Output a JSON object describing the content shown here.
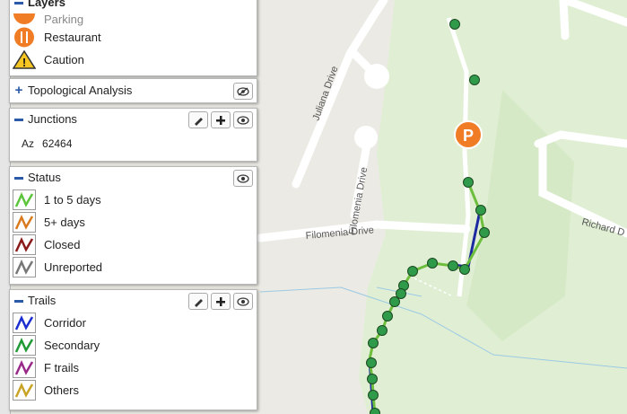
{
  "map": {
    "street_labels": [
      "Juliana Drive",
      "Filomenia Drive",
      "Richard D"
    ],
    "parking_marker": "P",
    "colors": {
      "map_bg": "#ebeae4",
      "park": "#e0efd4",
      "park_dark": "#cde3bd",
      "road": "#ffffff",
      "water": "#9cc9e4",
      "trail_green": "#6dbe3d",
      "trail_blue": "#1b2aa0",
      "node_fill": "#2f9a49",
      "parking": "#f07d26"
    }
  },
  "layers_panel": {
    "title": "Layers",
    "items": [
      {
        "label": "Parking",
        "icon": "parking-icon"
      },
      {
        "label": "Restaurant",
        "icon": "restaurant-icon"
      },
      {
        "label": "Caution",
        "icon": "caution-icon"
      }
    ]
  },
  "topological_panel": {
    "title": "Topological Analysis",
    "collapsed_symbol": "+"
  },
  "junctions_panel": {
    "title": "Junctions",
    "prefix": "Az",
    "value": "62464"
  },
  "status_panel": {
    "title": "Status",
    "items": [
      {
        "label": "1 to 5 days",
        "color": "#5cc53a"
      },
      {
        "label": "5+ days",
        "color": "#d97a1f"
      },
      {
        "label": "Closed",
        "color": "#8a1a1a"
      },
      {
        "label": "Unreported",
        "color": "#777777"
      }
    ]
  },
  "trails_panel": {
    "title": "Trails",
    "items": [
      {
        "label": "Corridor",
        "color": "#1c2ed0"
      },
      {
        "label": "Secondary",
        "color": "#1f9a35"
      },
      {
        "label": "F trails",
        "color": "#9a2a8a"
      },
      {
        "label": "Others",
        "color": "#c9a324"
      }
    ]
  }
}
